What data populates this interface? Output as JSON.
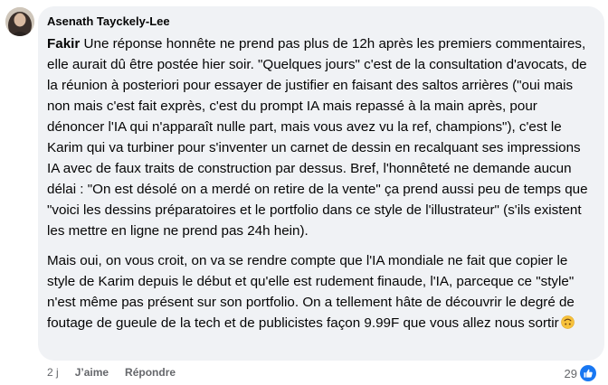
{
  "comment": {
    "author": "Asenath Tayckely-Lee",
    "mention": "Fakir",
    "paragraph1_rest": " Une réponse honnête ne prend pas plus de 12h après les premiers commentaires, elle aurait dû être postée hier soir. \"Quelques jours\" c'est de la consultation d'avocats, de la réunion à posteriori pour essayer de justifier en faisant des saltos arrières (\"oui mais non mais c'est fait exprès, c'est du prompt IA mais repassé à la main après, pour dénoncer l'IA qui n'apparaît nulle part, mais vous avez vu la ref, champions\"), c'est le Karim qui va turbiner pour s'inventer un carnet de dessin en recalquant ses impressions IA avec de faux traits de construction par dessus. Bref, l'honnêteté ne demande aucun délai : \"On est désolé on a merdé on retire de la vente\" ça prend aussi peu de temps que \"voici les dessins préparatoires et le portfolio dans ce style de l'illustrateur\" (s'ils existent les mettre en ligne ne prend pas 24h hein).",
    "paragraph2": "Mais oui, on vous croit, on va se rendre compte que l'IA mondiale ne fait que copier le style de Karim depuis le début et qu'elle est rudement finaude, l'IA, parceque ce \"style\" n'est même pas présent sur son portfolio. On a tellement hâte de découvrir le degré de foutage de gueule de la tech et de publicistes façon 9.99F que vous allez nous sortir",
    "emoji_icon": "upside-down-face-icon"
  },
  "actions": {
    "time": "2 j",
    "like_label": "J’aime",
    "reply_label": "Répondre"
  },
  "reactions": {
    "count": "29",
    "icon": "like-icon",
    "color": "#1877f2"
  }
}
